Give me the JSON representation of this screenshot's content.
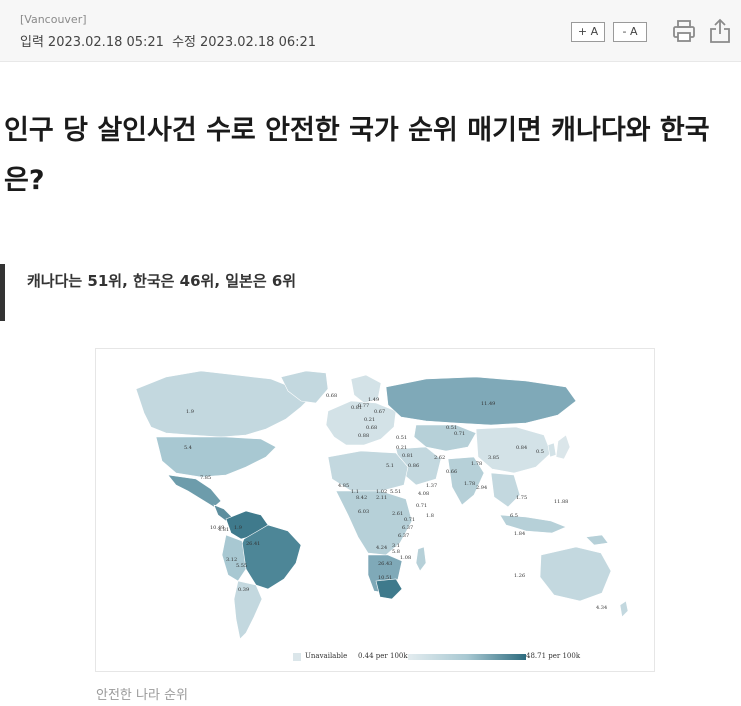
{
  "header": {
    "location": "[Vancouver]",
    "published_label": "입력",
    "published": "2023.02.18 05:21",
    "modified_label": "수정",
    "modified": "2023.02.18 06:21",
    "font_increase": "+ A",
    "font_decrease": "- A"
  },
  "article": {
    "headline": "인구 당 살인사건 수로 안전한 국가 순위 매기면 캐나다와 한국은?",
    "subhead": "캐나다는 51위, 한국은 46위, 일본은 6위",
    "caption": "안전한 나라 순위"
  },
  "map": {
    "legend": {
      "unavailable": "Unavailable",
      "min": "0.44 per 100k",
      "max": "48.71 per 100k"
    },
    "labels": [
      "0.68",
      "1.49",
      "0.81",
      "0.77",
      "0.67",
      "1.9",
      "0.21",
      "0.68",
      "11.49",
      "0.51",
      "0.71",
      "0.88",
      "0.51",
      "0.84",
      "0.5",
      "5.4",
      "0.21",
      "0.81",
      "3.85",
      "2.62",
      "1.78",
      "0.66",
      "0.86",
      "7.85",
      "4.85",
      "1.1",
      "1.02",
      "5.51",
      "4.08",
      "1.37",
      "1.78",
      "5.1",
      "8.42",
      "2.11",
      "0.71",
      "2.94",
      "11.88",
      "6.03",
      "2.61",
      "1.75",
      "0.71",
      "1.8",
      "6.5",
      "26.41",
      "4.81",
      "1.9",
      "1.84",
      "6.37",
      "10.49",
      "6.37",
      "3.1",
      "4.24",
      "5.8",
      "1.08",
      "26.43",
      "3.12",
      "5.55",
      "0.39",
      "10.51",
      "1.26",
      "4.34"
    ],
    "colors": {
      "unavailable": "#dbe6ea",
      "low": "#c3d8df",
      "mid": "#7fa9b8",
      "high": "#2d6b7e"
    }
  }
}
